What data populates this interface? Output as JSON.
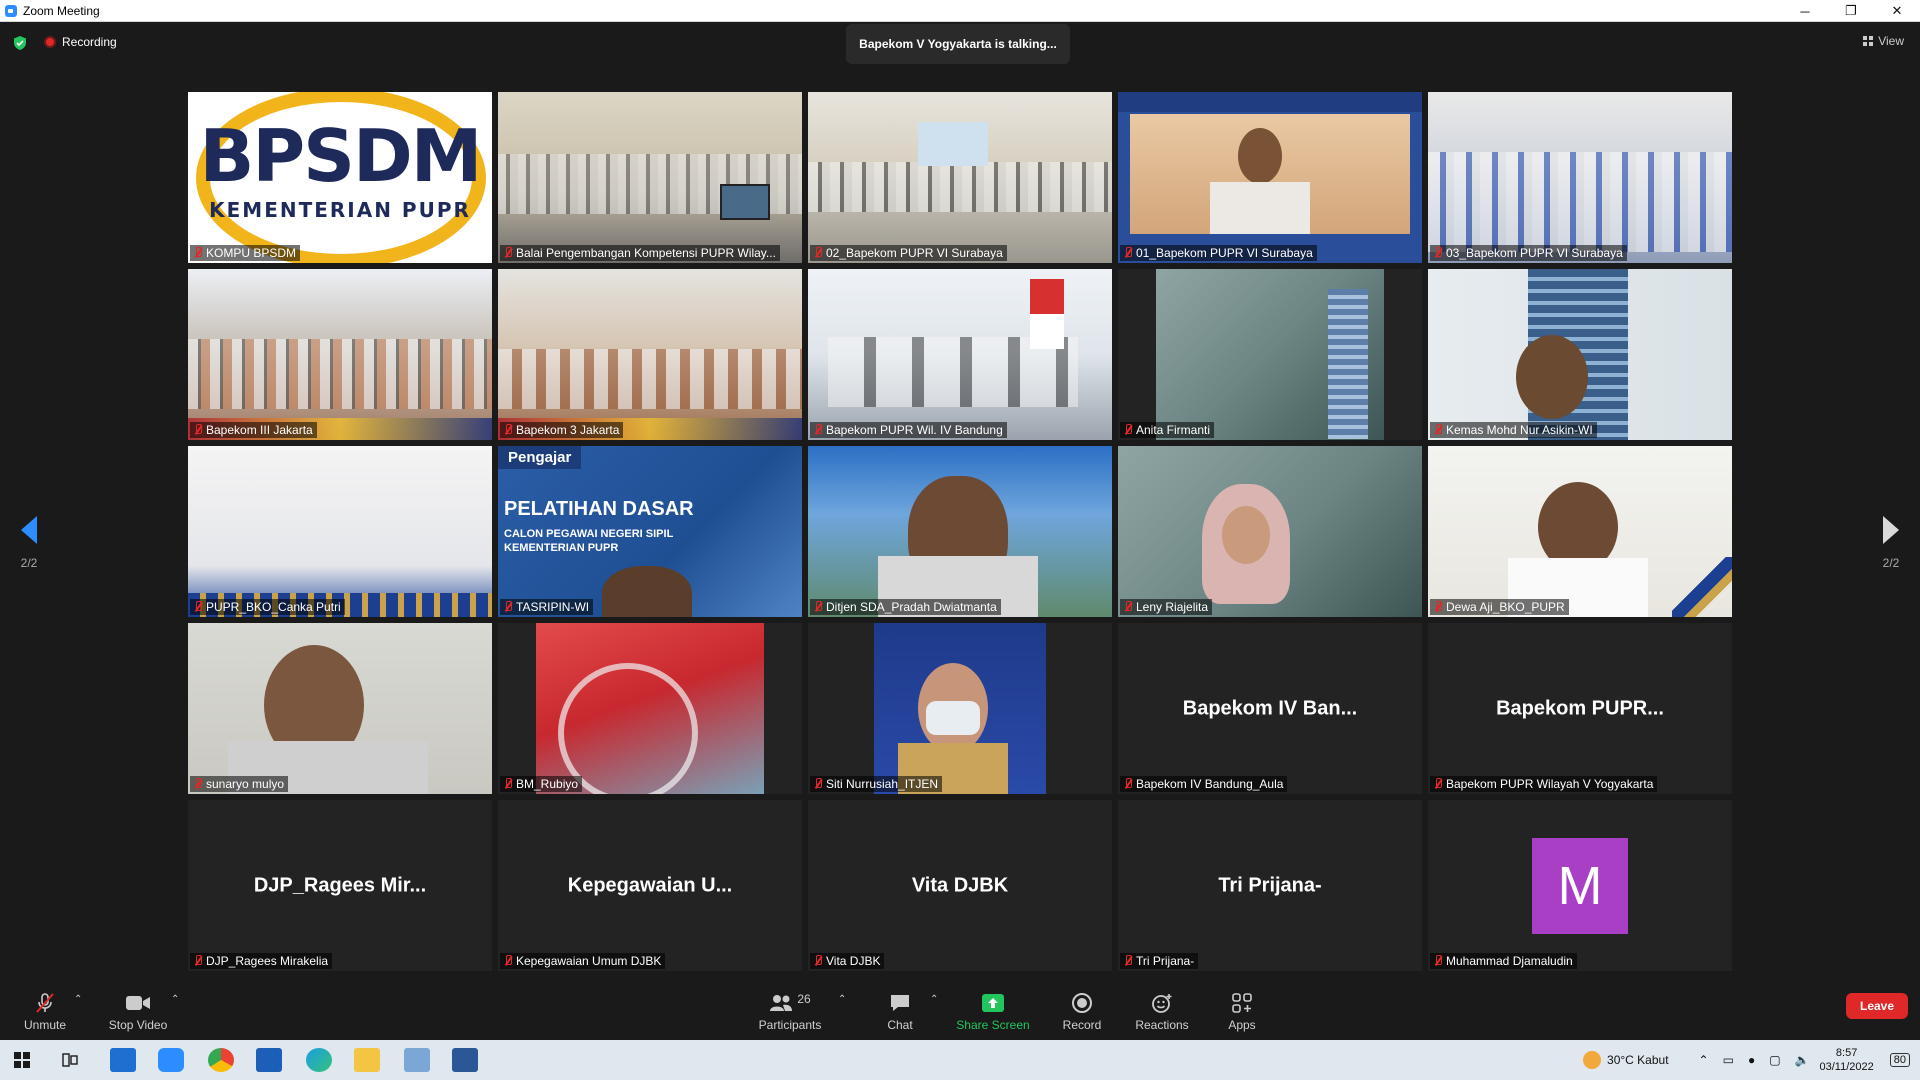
{
  "window": {
    "title": "Zoom Meeting",
    "minimize": "─",
    "restore": "❐",
    "close": "✕"
  },
  "topbar": {
    "recording_label": "Recording",
    "talking_banner": "Bapekom V Yogyakarta is talking...",
    "view_label": "View"
  },
  "colors": {
    "accent": "#2d8cff",
    "recording": "#e02828",
    "share": "#22c55e",
    "leave": "#e02828",
    "avatar": "#a83fc4"
  },
  "gallery": {
    "page_left": "2/2",
    "page_right": "2/2",
    "tiles": [
      {
        "label": "KOMPU BPSDM",
        "type": "video",
        "logo_line1": "BPSDM",
        "logo_line2": "KEMENTERIAN PUPR"
      },
      {
        "label": "Balai Pengembangan Kompetensi PUPR Wilay...",
        "type": "video"
      },
      {
        "label": "02_Bapekom PUPR VI Surabaya",
        "type": "video"
      },
      {
        "label": "01_Bapekom PUPR VI Surabaya",
        "type": "video"
      },
      {
        "label": "03_Bapekom PUPR VI Surabaya",
        "type": "video"
      },
      {
        "label": "Bapekom III Jakarta",
        "type": "video"
      },
      {
        "label": "Bapekom 3 Jakarta",
        "type": "video"
      },
      {
        "label": "Bapekom PUPR Wil. IV Bandung",
        "type": "video"
      },
      {
        "label": "Anita Firmanti",
        "type": "video"
      },
      {
        "label": "Kemas Mohd Nur Asikin-WI",
        "type": "video"
      },
      {
        "label": "PUPR_BKO_Canka Putri",
        "type": "video"
      },
      {
        "label": "TASRIPIN-WI",
        "type": "video",
        "slide_tag": "Pengajar",
        "slide_title": "PELATIHAN DASAR",
        "slide_sub1": "CALON PEGAWAI NEGERI SIPIL",
        "slide_sub2": "KEMENTERIAN PUPR"
      },
      {
        "label": "Ditjen SDA_Pradah Dwiatmanta",
        "type": "video"
      },
      {
        "label": "Leny Riajelita",
        "type": "video"
      },
      {
        "label": "Dewa Aji_BKO_PUPR",
        "type": "video"
      },
      {
        "label": "sunaryo mulyo",
        "type": "video"
      },
      {
        "label": "BM_Rubiyo",
        "type": "video"
      },
      {
        "label": "Siti Nurrusiah_ITJEN",
        "type": "video"
      },
      {
        "label": "Bapekom IV Bandung_Aula",
        "type": "name",
        "big": "Bapekom IV Ban..."
      },
      {
        "label": "Bapekom PUPR Wilayah V Yogyakarta",
        "type": "name",
        "big": "Bapekom PUPR..."
      },
      {
        "label": "DJP_Ragees Mirakelia",
        "type": "name",
        "big": "DJP_Ragees Mir..."
      },
      {
        "label": "Kepegawaian Umum DJBK",
        "type": "name",
        "big": "Kepegawaian U..."
      },
      {
        "label": "Vita DJBK",
        "type": "name",
        "big": "Vita DJBK"
      },
      {
        "label": "Tri Prijana-",
        "type": "name",
        "big": "Tri Prijana-"
      },
      {
        "label": "Muhammad Djamaludin",
        "type": "avatar",
        "initial": "M"
      }
    ]
  },
  "toolbar": {
    "unmute": "Unmute",
    "stop_video": "Stop Video",
    "participants": "Participants",
    "participants_count": "26",
    "chat": "Chat",
    "share_screen": "Share Screen",
    "record": "Record",
    "reactions": "Reactions",
    "apps": "Apps",
    "leave": "Leave"
  },
  "taskbar": {
    "weather": "30°C  Kabut",
    "time": "8:57",
    "date": "03/11/2022",
    "notifications": "80"
  }
}
